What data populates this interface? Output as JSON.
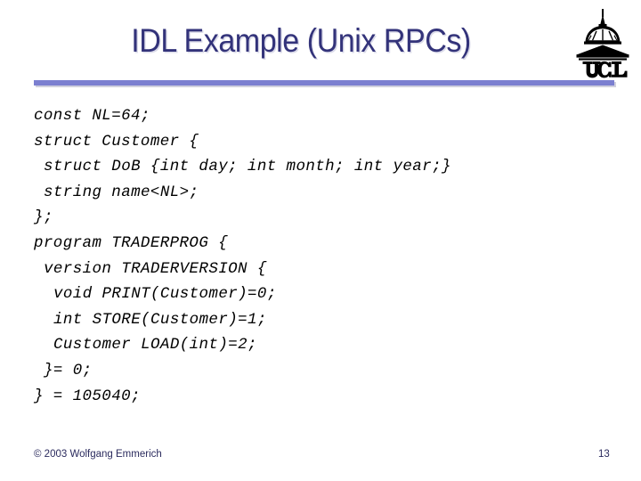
{
  "slide": {
    "title": "IDL Example (Unix RPCs)",
    "title_color": "#33337a",
    "background_color": "#ffffff",
    "divider_color": "#7b7fd0",
    "logo": {
      "name": "ucl-logo",
      "text": "UCL",
      "alt": "University College London dome and portico emblem"
    },
    "code": {
      "language": "Sun RPC / ONC IDL",
      "text_color": "#000000",
      "lines": [
        {
          "indent": 0,
          "text": "const NL=64;"
        },
        {
          "indent": 0,
          "text": "struct Customer {"
        },
        {
          "indent": 1,
          "text": "struct DoB {int day; int month; int year;}"
        },
        {
          "indent": 1,
          "text": "string name<NL>;"
        },
        {
          "indent": 0,
          "text": "};"
        },
        {
          "indent": 0,
          "text": "program TRADERPROG {"
        },
        {
          "indent": 1,
          "text": "version TRADERVERSION {"
        },
        {
          "indent": 2,
          "text": "void PRINT(Customer)=0;"
        },
        {
          "indent": 2,
          "text": "int STORE(Customer)=1;"
        },
        {
          "indent": 2,
          "text": "Customer LOAD(int)=2;"
        },
        {
          "indent": 1,
          "text": "}= 0;"
        },
        {
          "indent": 0,
          "text": "} = 105040;"
        }
      ]
    },
    "footer": {
      "copyright": "© 2003 Wolfgang Emmerich",
      "page_number": "13",
      "text_color": "#2b2b5e"
    }
  }
}
